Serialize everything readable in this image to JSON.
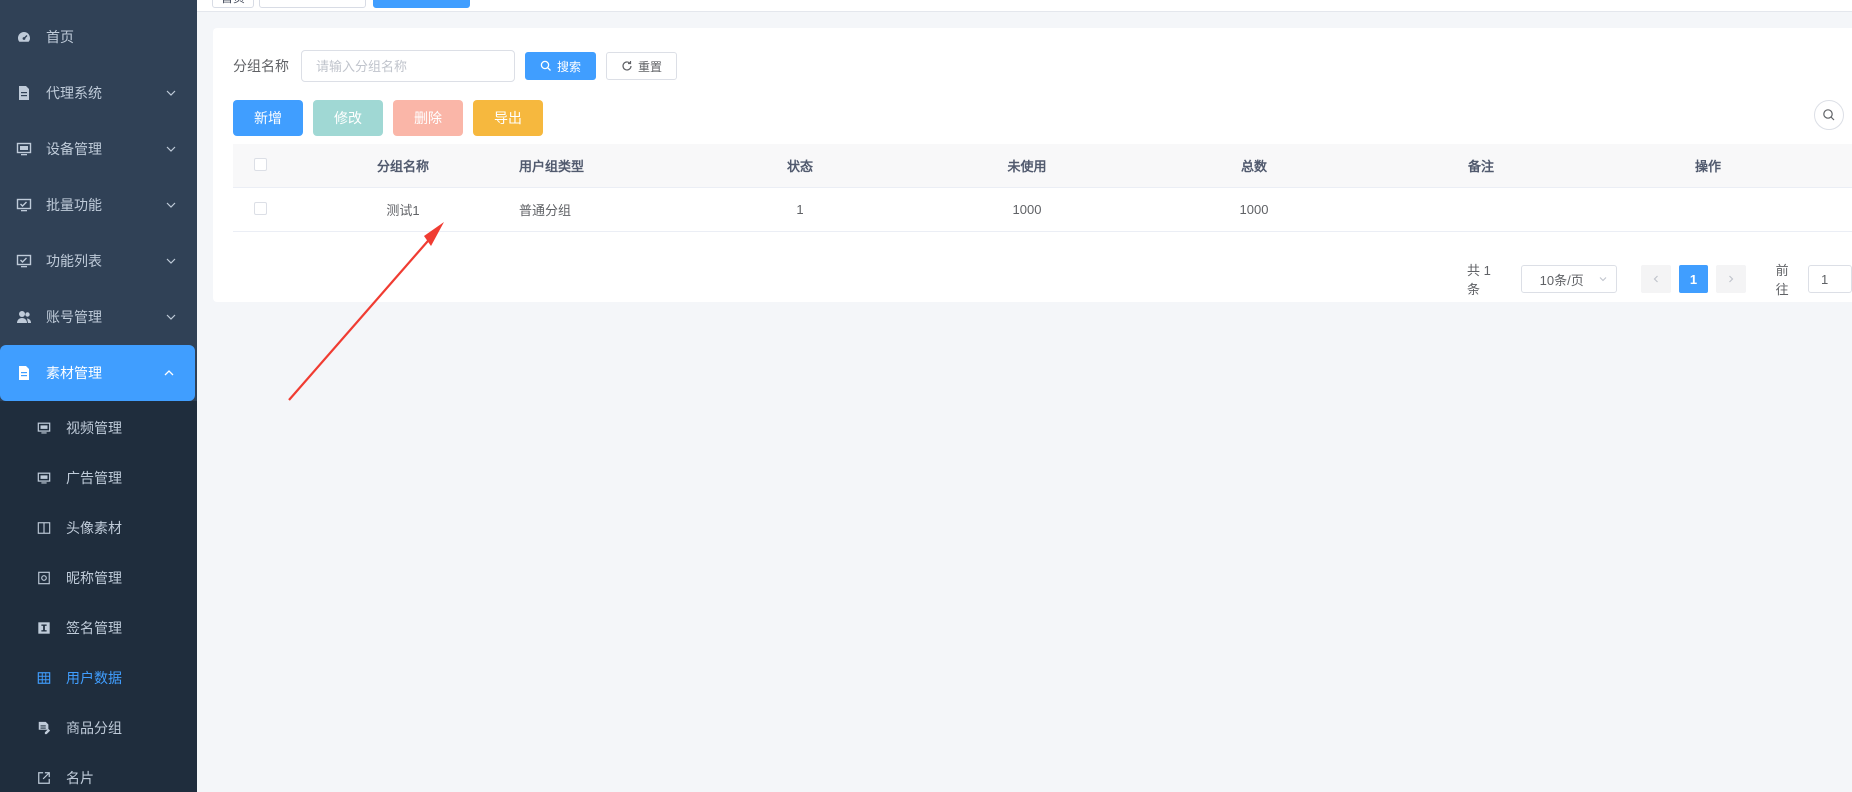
{
  "sidebar": {
    "items": [
      {
        "label": "首页",
        "icon": "dashboard-icon",
        "has_chevron": false
      },
      {
        "label": "代理系统",
        "icon": "document-icon",
        "has_chevron": true
      },
      {
        "label": "设备管理",
        "icon": "monitor-icon",
        "has_chevron": true
      },
      {
        "label": "批量功能",
        "icon": "monitor-check-icon",
        "has_chevron": true
      },
      {
        "label": "功能列表",
        "icon": "monitor-check-icon",
        "has_chevron": true
      },
      {
        "label": "账号管理",
        "icon": "user-group-icon",
        "has_chevron": true
      },
      {
        "label": "素材管理",
        "icon": "document-icon",
        "has_chevron": true,
        "expanded": true
      }
    ],
    "submenu": [
      {
        "label": "视频管理",
        "icon": "monitor-icon"
      },
      {
        "label": "广告管理",
        "icon": "monitor-icon"
      },
      {
        "label": "头像素材",
        "icon": "book-icon"
      },
      {
        "label": "昵称管理",
        "icon": "settings-box-icon"
      },
      {
        "label": "签名管理",
        "icon": "text-box-icon"
      },
      {
        "label": "用户数据",
        "icon": "grid-icon",
        "selected": true
      },
      {
        "label": "商品分组",
        "icon": "file-edit-icon"
      },
      {
        "label": "名片",
        "icon": "external-link-icon"
      }
    ],
    "active_color": "#409eff",
    "bg_color": "#304156"
  },
  "tags": {
    "items": [
      "首页",
      "",
      ""
    ]
  },
  "search": {
    "label": "分组名称",
    "placeholder": "请输入分组名称",
    "value": "",
    "search_button": "搜索",
    "reset_button": "重置"
  },
  "toolbar": {
    "add": "新增",
    "edit": "修改",
    "delete": "删除",
    "export": "导出"
  },
  "table": {
    "columns": [
      "分组名称",
      "用户组类型",
      "状态",
      "未使用",
      "总数",
      "备注",
      "操作"
    ],
    "rows": [
      {
        "name": "测试1",
        "type": "普通分组",
        "status": "1",
        "unused": "1000",
        "total": "1000",
        "remark": "",
        "actions": ""
      }
    ]
  },
  "pagination": {
    "total_text": "共 1 条",
    "page_size": "10条/页",
    "current_page": "1",
    "goto_label": "前往",
    "goto_value": "1"
  },
  "annotation": {
    "arrow_color": "#f03c32"
  }
}
